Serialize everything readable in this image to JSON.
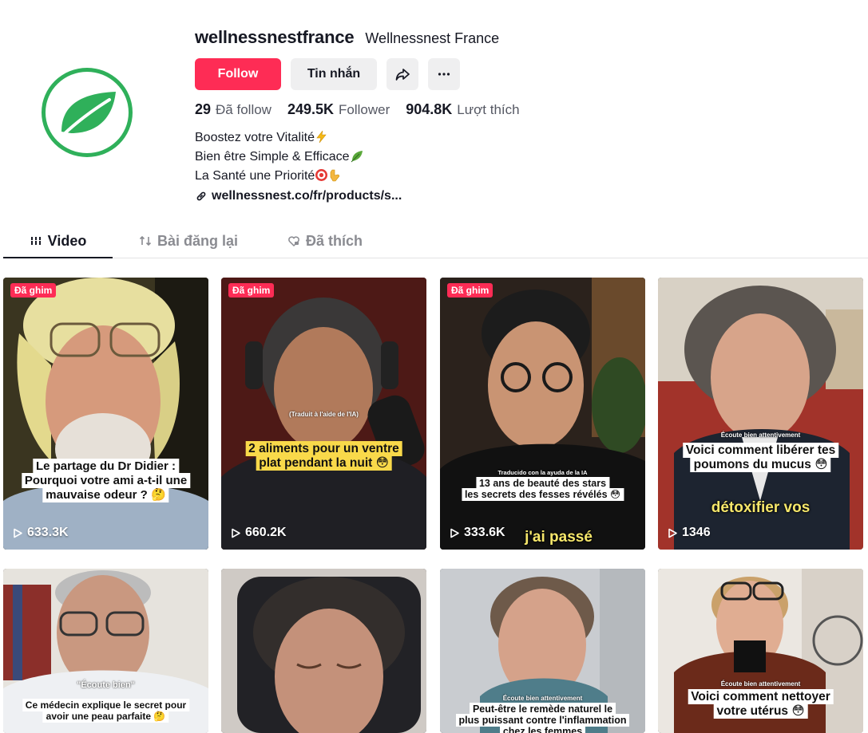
{
  "profile": {
    "username": "wellnessnestfrance",
    "nickname": "Wellnessnest France",
    "follow_label": "Follow",
    "message_label": "Tin nhắn",
    "share_icon": "share-icon",
    "more_icon": "more-dots-icon",
    "avatar_icon": "leaf-logo",
    "brand_color": "#2fb05a",
    "accent_color": "#fe2c55",
    "stats": {
      "following_value": "29",
      "following_label": "Đã follow",
      "followers_value": "249.5K",
      "followers_label": "Follower",
      "likes_value": "904.8K",
      "likes_label": "Lượt thích"
    },
    "bio": [
      {
        "text": "Boostez votre Vitalité",
        "emoji": "lightning-emoji"
      },
      {
        "text": "Bien être Simple & Efficace",
        "emoji": "leaf-emoji"
      },
      {
        "text": "La Santé une Priorité",
        "emoji": "target-pointing-emoji"
      }
    ],
    "link_text": "wellnessnest.co/fr/products/s..."
  },
  "tabs": [
    {
      "label": "Video",
      "icon": "grid-icon",
      "active": true
    },
    {
      "label": "Bài đăng lại",
      "icon": "repost-icon",
      "active": false
    },
    {
      "label": "Đã thích",
      "icon": "heart-icon",
      "active": false
    }
  ],
  "videos": [
    {
      "pinned_label": "Đã ghim",
      "views": "633.3K",
      "caption": [
        "Le partage du Dr Didier :",
        "Pourquoi votre ami a-t-il une",
        "mauvaise odeur ? 🤔"
      ]
    },
    {
      "pinned_label": "Đã ghim",
      "views": "660.2K",
      "subtitle": "(Traduit à l'aide de l'IA)",
      "caption": [
        "2 aliments pour un ventre",
        "plat pendant la nuit 😳"
      ]
    },
    {
      "pinned_label": "Đã ghim",
      "views": "333.6K",
      "subtitle": "Traducido con la ayuda de la IA",
      "caption": [
        "13 ans de beauté des stars",
        "les secrets des fesses révélés 😳"
      ],
      "overlay": "j'ai passé"
    },
    {
      "views": "1346",
      "subtitle": "Écoute bien attentivement",
      "caption": [
        "Voici comment libérer tes",
        "poumons du mucus 😳"
      ],
      "overlay": "détoxifier vos"
    },
    {
      "subtitle": "\"Écoute bien\"",
      "caption": [
        "Ce médecin explique le secret pour",
        "avoir une peau parfaite 🤔"
      ]
    },
    {},
    {
      "subtitle": "Écoute bien attentivement",
      "caption": [
        "Peut-être le remède naturel le",
        "plus puissant contre l'inflammation",
        "chez les femmes"
      ]
    },
    {
      "subtitle": "Écoute bien attentivement",
      "caption": [
        "Voici comment nettoyer",
        "votre utérus 😳"
      ]
    }
  ]
}
